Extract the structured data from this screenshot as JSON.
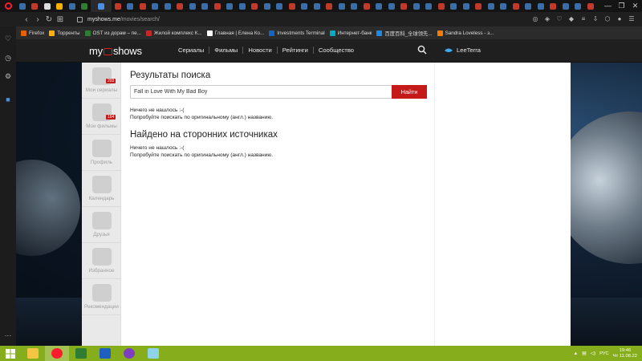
{
  "browser": {
    "address": {
      "host": "myshows.me",
      "path": "/movies/search/"
    },
    "tab_count": 46,
    "window_controls": [
      "—",
      "❐",
      "✕"
    ]
  },
  "bookmarks": [
    {
      "label": "Firefox",
      "color": "#e66000"
    },
    {
      "label": "Торренты",
      "color": "#ffb000"
    },
    {
      "label": "OST из дорам – пе...",
      "color": "#2e7d32"
    },
    {
      "label": "Жилой комплекс К...",
      "color": "#c62828"
    },
    {
      "label": "Главная | Елена Ко...",
      "color": "#ffffff"
    },
    {
      "label": "Investments Terminal",
      "color": "#1565c0"
    },
    {
      "label": "Интернет-банк",
      "color": "#00acc1"
    },
    {
      "label": "百度百科_全球领先...",
      "color": "#1e88e5"
    },
    {
      "label": "Sandra Loveless - з...",
      "color": "#f57c00"
    }
  ],
  "site": {
    "logo_left": "my",
    "logo_right": "shows",
    "nav": [
      "Сериалы",
      "Фильмы",
      "Новости",
      "Рейтинги",
      "Сообщество"
    ],
    "user_name": "LeeTerra"
  },
  "sidebar": [
    {
      "label": "Мои сериалы",
      "badge": "203"
    },
    {
      "label": "Мои фильмы",
      "badge": "164"
    },
    {
      "label": "Профиль",
      "badge": null
    },
    {
      "label": "Календарь",
      "badge": null
    },
    {
      "label": "Друзья",
      "badge": null
    },
    {
      "label": "Избранное",
      "badge": null
    },
    {
      "label": "Рекомендации",
      "badge": null
    }
  ],
  "search": {
    "title": "Результаты поиска",
    "query": "Fall in Love With My Bad Boy",
    "button": "Найти",
    "empty": "Ничего не нашлось :-(",
    "hint": "Попробуйте поискать по оригинальному (англ.) названию."
  },
  "external": {
    "title": "Найдено на сторонних источниках",
    "empty": "Ничего не нашлось :-(",
    "hint": "Попробуйте поискать по оригинальному (англ.) названию."
  },
  "taskbar": {
    "lang": "РУС",
    "time": "19:46",
    "date": "Чт 11.08.22"
  },
  "colors": {
    "accent": "#c41a1a",
    "taskbar": "#86ad1b"
  }
}
